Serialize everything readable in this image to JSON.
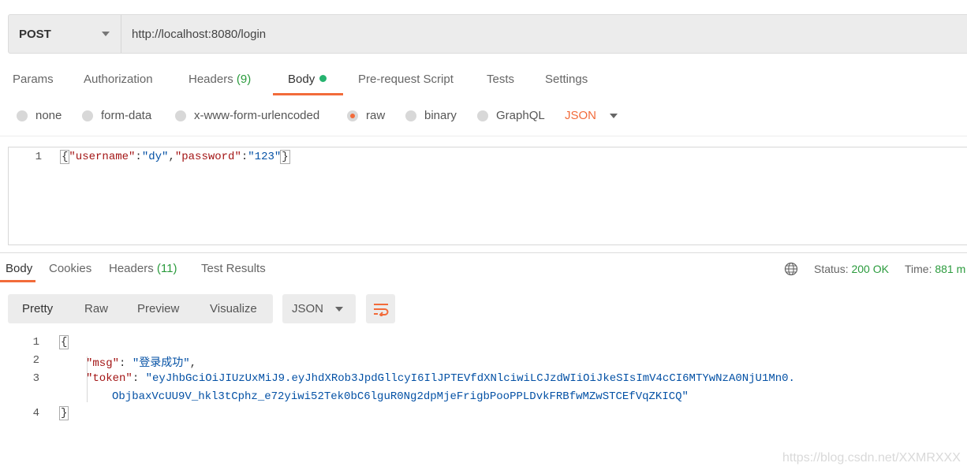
{
  "request": {
    "method": "POST",
    "url": "http://localhost:8080/login"
  },
  "request_tabs": {
    "params": "Params",
    "authorization": "Authorization",
    "headers": "Headers",
    "headers_count": "(9)",
    "body": "Body",
    "prerequest": "Pre-request Script",
    "tests": "Tests",
    "settings": "Settings"
  },
  "body_types": {
    "none": "none",
    "form_data": "form-data",
    "urlencoded": "x-www-form-urlencoded",
    "raw": "raw",
    "binary": "binary",
    "graphql": "GraphQL",
    "selected_format": "JSON"
  },
  "request_editor": {
    "line_number": "1",
    "open_brace": "{",
    "key1": "\"username\"",
    "colon": ":",
    "val1": "\"dy\"",
    "comma": ",",
    "key2": "\"password\"",
    "val2": "\"123\"",
    "close_brace": "}"
  },
  "response_tabs": {
    "body": "Body",
    "cookies": "Cookies",
    "headers": "Headers",
    "headers_count": "(11)",
    "test_results": "Test Results"
  },
  "status": {
    "status_label": "Status:",
    "status_value": "200 OK",
    "time_label": "Time:",
    "time_value": "881 m"
  },
  "view_modes": {
    "pretty": "Pretty",
    "raw": "Raw",
    "preview": "Preview",
    "visualize": "Visualize",
    "format": "JSON"
  },
  "response_editor": {
    "line_numbers": [
      "1",
      "2",
      "3",
      "4"
    ],
    "open_brace": "{",
    "msg_key": "\"msg\"",
    "msg_value": "\"登录成功\"",
    "token_key": "\"token\"",
    "token_value_part1": "\"eyJhbGciOiJIUzUxMiJ9.eyJhdXRob3JpdGllcyI6IlJPTEVfdXNlciwiLCJzdWIiOiJkeSIsImV4cCI6MTYwNzA0NjU1Mn0.",
    "token_value_part2": "ObjbaxVcUU9V_hkl3tCphz_e72yiwi52Tek0bC6lguR0Ng2dpMjeFrigbPooPPLDvkFRBfwMZwSTCEfVqZKICQ\"",
    "close_brace": "}"
  },
  "watermark": "https://blog.csdn.net/XXMRXXX",
  "colors": {
    "accent": "#f26b3a",
    "success": "#2b9b3d",
    "json_key": "#a31515",
    "json_string": "#0451a5"
  }
}
